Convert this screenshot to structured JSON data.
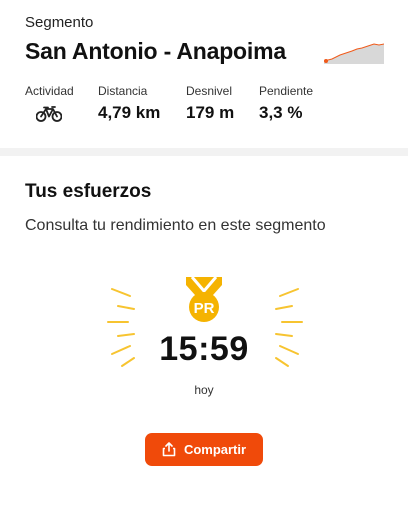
{
  "segment": {
    "kicker": "Segmento",
    "title": "San Antonio - Anapoima",
    "stats": {
      "activity": {
        "label": "Actividad",
        "icon": "bike-icon"
      },
      "distance": {
        "label": "Distancia",
        "value": "4,79 km"
      },
      "elevation": {
        "label": "Desnivel",
        "value": "179 m"
      },
      "grade": {
        "label": "Pendiente",
        "value": "3,3 %"
      }
    }
  },
  "efforts": {
    "title": "Tus esfuerzos",
    "subtitle": "Consulta tu rendimiento en este segmento",
    "badge": {
      "text": "PR",
      "color": "#f5b301"
    },
    "time": "15:59",
    "when": "hoy"
  },
  "share": {
    "label": "Compartir",
    "icon": "share-icon",
    "color": "#f04a0a"
  }
}
